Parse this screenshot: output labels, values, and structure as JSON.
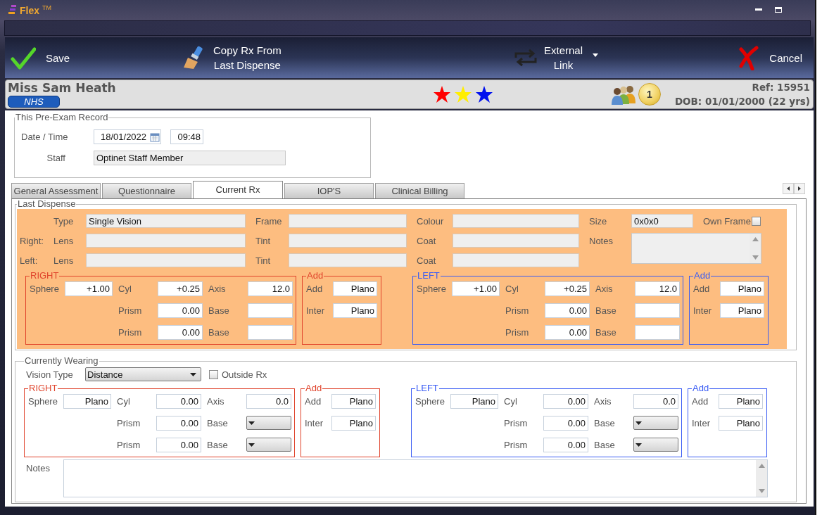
{
  "window": {
    "title": "Flex $^{TM}$"
  },
  "toolbar": [
    {
      "kind": "save",
      "lines": [
        "Save"
      ],
      "dropdown": false
    },
    {
      "kind": "copy",
      "lines": [
        "Copy Rx From",
        "Last Dispense"
      ],
      "dropdown": false
    },
    {
      "kind": "link",
      "lines": [
        "External",
        "Link"
      ],
      "dropdown": true
    },
    {
      "kind": "cancel",
      "lines": [
        "Cancel"
      ],
      "dropdown": false
    }
  ],
  "patient": {
    "name": "Miss Sam Heath",
    "badge": "NHS",
    "flags": [
      {
        "color": "#ff0000"
      },
      {
        "color": "#ffee00"
      },
      {
        "color": "#0010ee"
      }
    ],
    "count": "1",
    "ref": "Ref: 15951",
    "dob": "DOB: 01/01/2000 (22 yrs)"
  },
  "pre_exam": {
    "legend": "This Pre-Exam Record",
    "date_label": "Date / Time",
    "date": "18/01/2022",
    "time": "09:48",
    "staff_label": "Staff",
    "staff": "Optinet Staff Member"
  },
  "tabs": [
    {
      "label": "General Assessment",
      "selected": false
    },
    {
      "label": "Questionnaire",
      "selected": false
    },
    {
      "label": "Current Rx",
      "selected": true
    },
    {
      "label": "IOP'S",
      "selected": false
    },
    {
      "label": "Clinical Billing",
      "selected": false
    }
  ],
  "last_dispense": {
    "legend": "Last Dispense",
    "rows": [
      {
        "cells": [
          {
            "kind": "label",
            "text": "Type"
          },
          {
            "kind": "field",
            "value": "Single Vision",
            "disabled": true
          },
          {
            "kind": "label",
            "text": "Frame"
          },
          {
            "kind": "field",
            "disabled": true
          },
          {
            "kind": "label",
            "text": "Colour"
          },
          {
            "kind": "field",
            "disabled": true
          },
          {
            "kind": "label",
            "text": "Size"
          },
          {
            "kind": "field",
            "value": "0x0x0",
            "disabled": true
          },
          {
            "kind": "label",
            "text": "Own Frame"
          },
          {
            "kind": "checkbox",
            "checked": false
          }
        ]
      },
      {
        "side": "Right:",
        "cells": [
          {
            "kind": "label",
            "text": "Lens"
          },
          {
            "kind": "field",
            "disabled": true
          },
          {
            "kind": "label",
            "text": "Tint"
          },
          {
            "kind": "field",
            "disabled": true
          },
          {
            "kind": "label",
            "text": "Coat"
          },
          {
            "kind": "field",
            "disabled": true
          },
          {
            "kind": "label",
            "text": "Notes"
          },
          {
            "kind": "notes",
            "disabled": true
          }
        ]
      },
      {
        "side": "Left:",
        "cells": [
          {
            "kind": "label",
            "text": "Lens"
          },
          {
            "kind": "field",
            "disabled": true
          },
          {
            "kind": "label",
            "text": "Tint"
          },
          {
            "kind": "field",
            "disabled": true
          },
          {
            "kind": "label",
            "text": "Coat"
          },
          {
            "kind": "field",
            "disabled": true
          }
        ]
      }
    ],
    "blocks": [
      {
        "kind": "right",
        "legend": "RIGHT",
        "sphere": {
          "label": "Sphere",
          "value": "+1.00"
        },
        "lines": [
          [
            {
              "label": "Cyl",
              "kind": "field",
              "value": "+0.25"
            },
            {
              "label": "Axis",
              "kind": "field",
              "value": "12.0"
            }
          ],
          [
            {
              "label": "Prism",
              "kind": "field",
              "value": "0.00"
            },
            {
              "label": "Base",
              "kind": "field"
            }
          ],
          [
            {
              "label": "Prism",
              "kind": "field",
              "value": "0.00"
            },
            {
              "label": "Base",
              "kind": "field"
            }
          ]
        ]
      },
      {
        "kind": "add_right",
        "legend": "Add",
        "items": [
          {
            "label": "Add",
            "value": "Plano"
          },
          {
            "label": "Inter",
            "value": "Plano"
          }
        ]
      },
      {
        "kind": "left",
        "legend": "LEFT",
        "sphere": {
          "label": "Sphere",
          "value": "+1.00"
        },
        "lines": [
          [
            {
              "label": "Cyl",
              "kind": "field",
              "value": "+0.25"
            },
            {
              "label": "Axis",
              "kind": "field",
              "value": "12.0"
            }
          ],
          [
            {
              "label": "Prism",
              "kind": "field",
              "value": "0.00"
            },
            {
              "label": "Base",
              "kind": "field"
            }
          ],
          [
            {
              "label": "Prism",
              "kind": "field",
              "value": "0.00"
            },
            {
              "label": "Base",
              "kind": "field"
            }
          ]
        ]
      },
      {
        "kind": "add_left",
        "legend": "Add",
        "items": [
          {
            "label": "Add",
            "value": "Plano"
          },
          {
            "label": "Inter",
            "value": "Plano"
          }
        ]
      }
    ]
  },
  "currently_wearing": {
    "legend": "Currently Wearing",
    "vision_label": "Vision Type",
    "vision": "Distance",
    "outside_label": "Outside Rx",
    "outside_checked": false,
    "blocks": [
      {
        "kind": "right",
        "legend": "RIGHT",
        "sphere": {
          "label": "Sphere",
          "value": "Plano"
        },
        "lines": [
          [
            {
              "label": "Cyl",
              "kind": "field",
              "value": "0.00"
            },
            {
              "label": "Axis",
              "kind": "field",
              "value": "0.0"
            }
          ],
          [
            {
              "label": "Prism",
              "kind": "field",
              "value": "0.00"
            },
            {
              "label": "Base",
              "kind": "select"
            }
          ],
          [
            {
              "label": "Prism",
              "kind": "field",
              "value": "0.00"
            },
            {
              "label": "Base",
              "kind": "select"
            }
          ]
        ]
      },
      {
        "kind": "add_right",
        "legend": "Add",
        "items": [
          {
            "label": "Add",
            "value": "Plano"
          },
          {
            "label": "Inter",
            "value": "Plano"
          }
        ]
      },
      {
        "kind": "left",
        "legend": "LEFT",
        "sphere": {
          "label": "Sphere",
          "value": "Plano"
        },
        "lines": [
          [
            {
              "label": "Cyl",
              "kind": "field",
              "value": "0.00"
            },
            {
              "label": "Axis",
              "kind": "field",
              "value": "0.0"
            }
          ],
          [
            {
              "label": "Prism",
              "kind": "field",
              "value": "0.00"
            },
            {
              "label": "Base",
              "kind": "select"
            }
          ],
          [
            {
              "label": "Prism",
              "kind": "field",
              "value": "0.00"
            },
            {
              "label": "Base",
              "kind": "select"
            }
          ]
        ]
      },
      {
        "kind": "add_left",
        "legend": "Add",
        "items": [
          {
            "label": "Add",
            "value": "Plano"
          },
          {
            "label": "Inter",
            "value": "Plano"
          }
        ]
      }
    ],
    "notes_label": "Notes"
  }
}
